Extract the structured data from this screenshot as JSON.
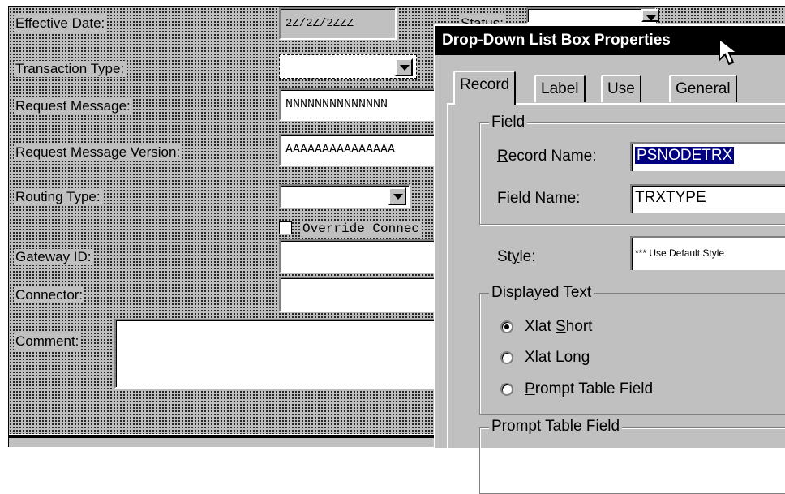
{
  "form": {
    "effective_date_label": "Effective Date:",
    "effective_date_value": "2Z/2Z/2ZZZ",
    "status_label": "Status:",
    "transaction_type_label": "Transaction Type:",
    "request_message_label": "Request Message:",
    "request_message_value": "NNNNNNNNNNNNNN",
    "request_message_version_label": "Request Message Version:",
    "request_message_version_value": "AAAAAAAAAAAAAAA",
    "routing_type_label": "Routing Type:",
    "override_connector_label": "Override Connec",
    "gateway_id_label": "Gateway ID:",
    "connector_label": "Connector:",
    "comment_label": "Comment:"
  },
  "dialog": {
    "title": "Drop-Down List Box Properties",
    "tabs": [
      {
        "label": "Record"
      },
      {
        "label": "Label"
      },
      {
        "label": "Use"
      },
      {
        "label": "General"
      }
    ],
    "field_group_title": "Field",
    "record_name_label_u": "R",
    "record_name_label_rest": "ecord Name:",
    "record_name_value": "PSNODETRX",
    "field_name_label_u": "F",
    "field_name_label_rest": "ield Name:",
    "field_name_value": "TRXTYPE",
    "style_label_a": "St",
    "style_label_u": "y",
    "style_label_b": "le:",
    "style_value": "*** Use Default Style",
    "displayed_text_title": "Displayed Text",
    "options": [
      {
        "a": "Xlat ",
        "u": "S",
        "b": "hort",
        "selected": true
      },
      {
        "a": "Xlat L",
        "u": "o",
        "b": "ng",
        "selected": false
      },
      {
        "a": "",
        "u": "P",
        "b": "rompt Table Field",
        "selected": false
      }
    ],
    "prompt_table_title": "Prompt Table Field"
  }
}
